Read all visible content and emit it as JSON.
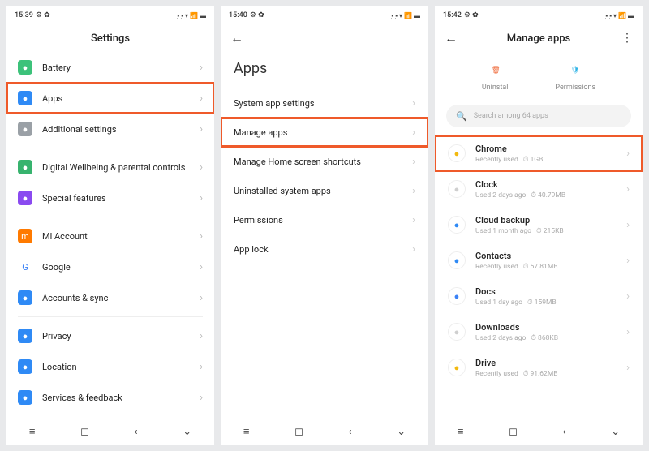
{
  "screen1": {
    "time": "15:39",
    "status_icons": "⚙ ✿",
    "net_icons": "📶 📶 📶 📡",
    "title": "Settings",
    "rows": [
      {
        "icon": "battery-icon",
        "color": "#3cc27a",
        "label": "Battery"
      },
      {
        "icon": "apps-icon",
        "color": "#2f8af5",
        "label": "Apps",
        "highlight": true
      },
      {
        "icon": "additional-icon",
        "color": "#9aa0a6",
        "label": "Additional settings"
      }
    ],
    "rows2": [
      {
        "icon": "wellbeing-icon",
        "color": "#37b36e",
        "label": "Digital Wellbeing & parental controls"
      },
      {
        "icon": "special-icon",
        "color": "#8a4af0",
        "label": "Special features"
      }
    ],
    "rows3": [
      {
        "icon": "mi-icon",
        "color": "#ff7a00",
        "label": "Mi Account",
        "glyph": "m"
      },
      {
        "icon": "google-icon",
        "color": "#ffffff",
        "label": "Google",
        "glyph": "G",
        "txt": "#3b82f6"
      },
      {
        "icon": "sync-icon",
        "color": "#2f8af5",
        "label": "Accounts & sync"
      }
    ],
    "rows4": [
      {
        "icon": "privacy-icon",
        "color": "#2f8af5",
        "label": "Privacy"
      },
      {
        "icon": "location-icon",
        "color": "#2f8af5",
        "label": "Location"
      },
      {
        "icon": "feedback-icon",
        "color": "#2f8af5",
        "label": "Services & feedback"
      }
    ]
  },
  "screen2": {
    "time": "15:40",
    "status_icons": "⚙ ✿ ⋯",
    "title": "Apps",
    "rows": [
      {
        "label": "System app settings"
      },
      {
        "label": "Manage apps",
        "highlight": true
      },
      {
        "label": "Manage Home screen shortcuts"
      },
      {
        "label": "Uninstalled system apps"
      },
      {
        "label": "Permissions"
      },
      {
        "label": "App lock"
      }
    ]
  },
  "screen3": {
    "time": "15:42",
    "status_icons": "⚙ ✿ ⋯",
    "title": "Manage apps",
    "actions": {
      "uninstall": "Uninstall",
      "permissions": "Permissions"
    },
    "search_placeholder": "Search among 64 apps",
    "apps": [
      {
        "icon": "chrome-icon",
        "tint": "#f2b90f",
        "name": "Chrome",
        "sub": "Recently used",
        "size": "1GB",
        "highlight": true
      },
      {
        "icon": "clock-icon",
        "tint": "#cfcfcf",
        "name": "Clock",
        "sub": "Used 2 days ago",
        "size": "40.79MB"
      },
      {
        "icon": "cloud-icon",
        "tint": "#2f8af5",
        "name": "Cloud backup",
        "sub": "Used 1 month ago",
        "size": "215KB"
      },
      {
        "icon": "contacts-icon",
        "tint": "#2f8af5",
        "name": "Contacts",
        "sub": "Recently used",
        "size": "57.81MB"
      },
      {
        "icon": "docs-icon",
        "tint": "#3b82f6",
        "name": "Docs",
        "sub": "Used 1 day ago",
        "size": "159MB"
      },
      {
        "icon": "downloads-icon",
        "tint": "#cfcfcf",
        "name": "Downloads",
        "sub": "Used 2 days ago",
        "size": "868KB"
      },
      {
        "icon": "drive-icon",
        "tint": "#f2b90f",
        "name": "Drive",
        "sub": "Recently used",
        "size": "91.62MB"
      }
    ]
  },
  "nav": {
    "menu": "≡",
    "home": "◻",
    "back": "‹",
    "down": "⌄"
  }
}
